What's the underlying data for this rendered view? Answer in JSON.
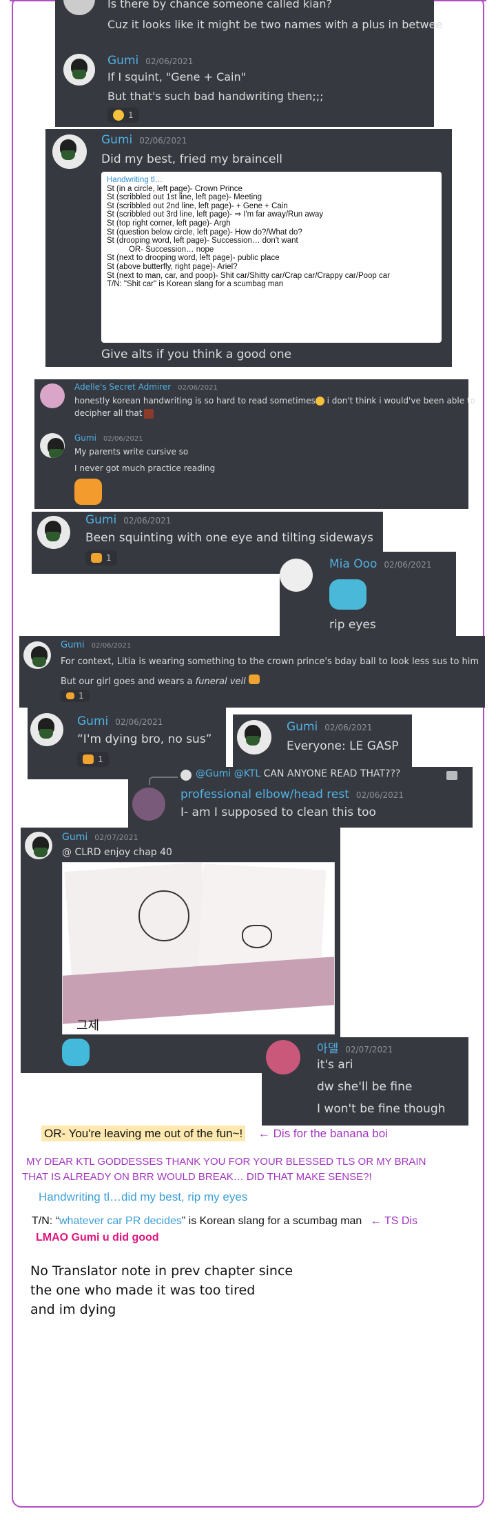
{
  "m1": {
    "line1": "Is there by chance someone called kian?",
    "line2": "Cuz it looks like it might be two names with a plus in betwee"
  },
  "m2": {
    "name": "Gumi",
    "time": "02/06/2021",
    "line1": "If I squint, \"Gene + Cain\"",
    "line2": "But that's such bad handwriting then;;;",
    "react_count": "1"
  },
  "m3": {
    "name": "Gumi",
    "time": "02/06/2021",
    "line1": "Did my best, fried my braincell",
    "tl_lines": [
      "Handwriting tl…",
      "St (in a circle, left page)- Crown Prince",
      "St (scribbled out 1st line, left page)- Meeting",
      "St (scribbled out 2nd line, left page)- + Gene + Cain",
      "St (scribbled out 3rd line, left page)- ⇒ I'm far away/Run away",
      "St (top right corner, left page)- Argh",
      "St (question below circle, left page)- How do?/What do?",
      "St (drooping word, left page)- Succession… don't want",
      "          OR- Succession… nope",
      "St (next to drooping word, left page)- public place",
      "St (above butterfly, right page)- Ariel?",
      "St (next to man, car, and poop)- Shit car/Shitty car/Crap car/Crappy car/Poop car",
      "T/N: \"Shit car\" is Korean slang for a scumbag man"
    ],
    "line2": "Give alts if you think a good one"
  },
  "m4": {
    "name": "Adelle's Secret Admirer",
    "time": "02/06/2021",
    "line1": "honestly korean handwriting is so hard to read sometimes",
    "line1b": " i don't think i would've been able to",
    "line2": "decipher all that",
    "name2": "Gumi",
    "time2": "02/06/2021",
    "line3": "My parents write cursive so",
    "line4": "I never got much practice reading"
  },
  "m5": {
    "name": "Gumi",
    "time": "02/06/2021",
    "line1": "Been squinting with one eye and tilting sideways",
    "react_count": "1"
  },
  "m6": {
    "name": "Mia Ooo",
    "time": "02/06/2021",
    "line1": "rip eyes"
  },
  "m7": {
    "name": "Gumi",
    "time": "02/06/2021",
    "line1": "For context, Litia is wearing something to the crown prince's bday ball to look less sus to him",
    "line2a": "But our girl goes and wears a ",
    "line2b": "funeral veil",
    "react_count": "1"
  },
  "m8": {
    "name": "Gumi",
    "time": "02/06/2021",
    "line1": "“I'm dying bro, no sus”",
    "react_count": "1"
  },
  "m9": {
    "name": "Gumi",
    "time": "02/06/2021",
    "line1": "Everyone: LE GASP"
  },
  "m10": {
    "reply_user": "@Gumi",
    "reply_mention": "@KTL",
    "reply_text": " CAN ANYONE READ THAT???",
    "name": "professional elbow/head rest",
    "time": "02/06/2021",
    "line1": "I- am I supposed to clean this too"
  },
  "m11": {
    "name": "Gumi",
    "time": "02/07/2021",
    "line1": "@ CLRD enjoy chap 40",
    "image_text": "그제"
  },
  "m12": {
    "name": "아델",
    "time": "02/07/2021",
    "line1": "it's ari",
    "line2": "dw she'll be fine",
    "line3": "I won't be fine though"
  },
  "footer": {
    "or_line": "OR- You're leaving me out of the fun~!",
    "or_note": "← Dis for the banana boi",
    "thanks1": "MY DEAR KTL GODDESSES THANK YOU FOR YOUR BLESSED TLS OR MY BRAIN",
    "thanks2": "THAT IS ALREADY ON BRR WOULD BREAK… DID THAT MAKE SENSE?!",
    "hw": "Handwriting tl…did my best, rip my eyes",
    "tn_a": "T/N: “",
    "tn_b": "whatever car PR decides",
    "tn_c": "” is Korean slang for a scumbag man",
    "tn_note": "← TS Dis",
    "lmao": "LMAO Gumi u did good",
    "note1": "No Translator note in prev chapter since",
    "note2": "the one who made it was too tired",
    "note3": "and im dying"
  },
  "colors": {
    "card_bg": "#36393f",
    "name_blue": "#52b2e6",
    "frame_purple": "#b04fc4",
    "footer_purple": "#a335c0",
    "footer_blue": "#3c9fd6",
    "pink": "#e0157f"
  }
}
